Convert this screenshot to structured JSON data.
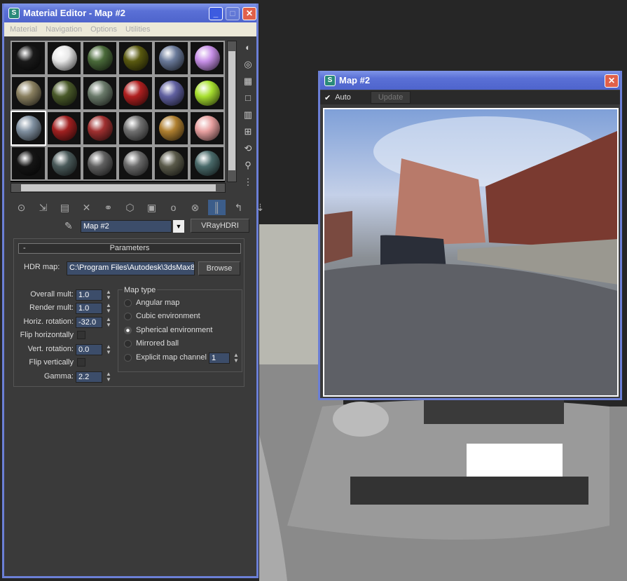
{
  "material_editor": {
    "title": "Material Editor - Map #2",
    "menu": [
      "Material",
      "Navigation",
      "Options",
      "Utilities"
    ],
    "slot_colors": [
      "#1a1a1a",
      "#e8e8e8",
      "#4a6a3a",
      "#5a5a10",
      "#6a7a9a",
      "#c890e8",
      "#8a8060",
      "#4a5a2a",
      "#6a7a6a",
      "#b02020",
      "#6060a0",
      "#a8e030",
      "#8090a0",
      "#a02020",
      "#a03030",
      "#707070",
      "#b08030",
      "#e8a0a0",
      "#151515",
      "#4a5a5a",
      "#606060",
      "#6a6a6a",
      "#5a5a4a",
      "#4a6a6a"
    ],
    "map_name": "Map #2",
    "map_type_button": "VRayHDRI",
    "rollout_title": "Parameters",
    "rollout_toggle": "-",
    "hdr_map_label": "HDR map:",
    "hdr_map_value": "C:\\Program Files\\Autodesk\\3dsMax8\\",
    "browse": "Browse",
    "params": [
      {
        "label": "Overall mult:",
        "value": "1.0"
      },
      {
        "label": "Render mult:",
        "value": "1.0"
      },
      {
        "label": "Horiz. rotation:",
        "value": "-32.0"
      },
      {
        "label": "Vert. rotation:",
        "value": "0.0"
      },
      {
        "label": "Gamma:",
        "value": "2.2"
      }
    ],
    "flip_horizontally": "Flip horizontally",
    "flip_vertically": "Flip vertically",
    "map_type": {
      "title": "Map type",
      "options": [
        "Angular map",
        "Cubic environment",
        "Spherical environment",
        "Mirrored ball",
        "Explicit map channel"
      ],
      "selected": "Spherical environment",
      "channel": "1"
    }
  },
  "map_window": {
    "title": "Map #2",
    "auto_label": "Auto",
    "auto_checked": true,
    "update_label": "Update"
  }
}
